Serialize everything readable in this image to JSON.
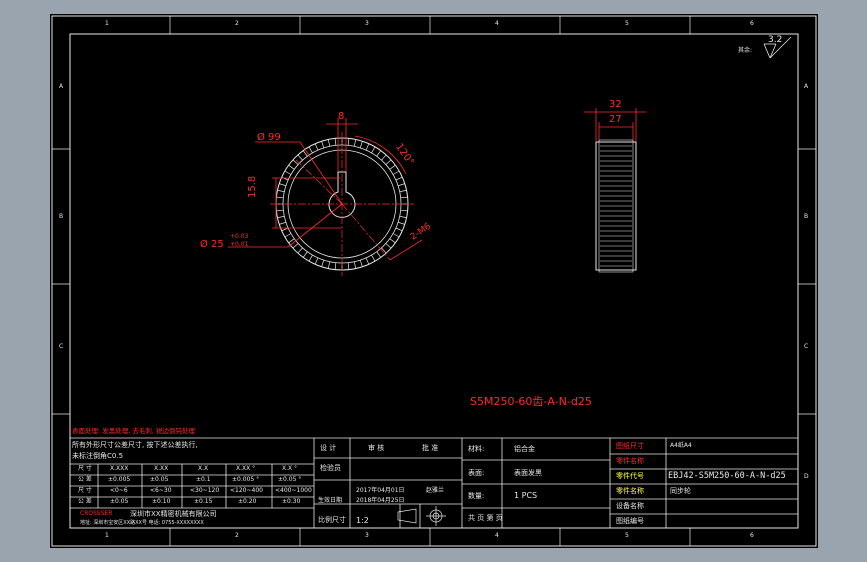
{
  "zone_labels": {
    "top": [
      "1",
      "2",
      "3",
      "4",
      "5",
      "6"
    ],
    "bottom": [
      "1",
      "2",
      "3",
      "4",
      "5",
      "6"
    ],
    "left": [
      "A",
      "B",
      "C"
    ],
    "right": [
      "A",
      "B",
      "C",
      "D"
    ]
  },
  "surface_finish": {
    "label": "其余:",
    "value": "3.2"
  },
  "front_view": {
    "dim_outer": "Ø 99",
    "dim_keyway_width": "8",
    "dim_keyway_depth": "15.8",
    "dim_angle": "120°",
    "dim_tapped_hole": "2-M6",
    "dim_bore": "Ø 25",
    "dim_bore_tol_upper": "+0.03",
    "dim_bore_tol_lower": "+0.01"
  },
  "side_view": {
    "dim_total_width": "32",
    "dim_face_width": "27"
  },
  "part_designation": "S5M250-60齿-A-N-d25",
  "notes": {
    "surface_treatment": "表面处理: 发黑处理, 去毛刺, 锐边倒钝处理",
    "general_tolerance_line1": "所有外形尺寸公差尺寸, 按下述公差执行,",
    "general_tolerance_line2": "未标注倒角C0.5"
  },
  "tolerance_table": {
    "headers": [
      "尺 寸",
      "X.XXX",
      "X.XX",
      "X.X",
      "X.XX °",
      "X.X °"
    ],
    "rows": [
      [
        "公 差",
        "±0.005",
        "±0.05",
        "±0.1",
        "±0.005 °",
        "±0.05 °"
      ],
      [
        "尺 寸",
        "<0~6",
        "<6~30",
        "<30~120",
        "<120~400",
        "<400~1000"
      ],
      [
        "公 差",
        "±0.05",
        "±0.10",
        "±0.15",
        "±0.20",
        "±0.30"
      ]
    ]
  },
  "company": {
    "logo": "CROSSSER",
    "name": "深圳市XX精密机械有限公司",
    "address": "地址: 深圳市宝安区XX路XX号 电话: 0755-XXXXXXXX"
  },
  "title_block": {
    "design_label": "设 计",
    "review_label": "审 核",
    "approve_label": "批 准",
    "checker_label": "检验员",
    "design_date": "2017年04月01日",
    "designer_name": "赵雅兰",
    "review_date_label": "生效日期",
    "review_date": "2018年04月25日",
    "scale_label": "比例尺寸",
    "scale_value": "1:2",
    "material_label": "材料:",
    "material_value": "铝合金",
    "surface_label": "表面:",
    "surface_value": "表面发黑",
    "quantity_label": "数量:",
    "quantity_value": "1 PCS",
    "sheet_label": "共  页  第  页",
    "drawing_no_label": "图纸尺寸",
    "drawing_no_value": "A4纸A4",
    "drawing_name_label": "零件名称",
    "code_label": "零件代号",
    "code_value": "EBJ42-S5M250-60-A-N-d25",
    "part_name_label": "零件名称",
    "part_name_value": "同步轮",
    "equipment_label": "设备名称",
    "drawing_label": "图纸编号"
  },
  "colors": {
    "line": "#e8e8e8",
    "dimension": "#ff2a2a",
    "centerline": "#ff2a2a",
    "label_red": "#ff2a2a",
    "label_yellow": "#ffff40",
    "sheet": "#000000",
    "background": "#9aa4ae"
  }
}
